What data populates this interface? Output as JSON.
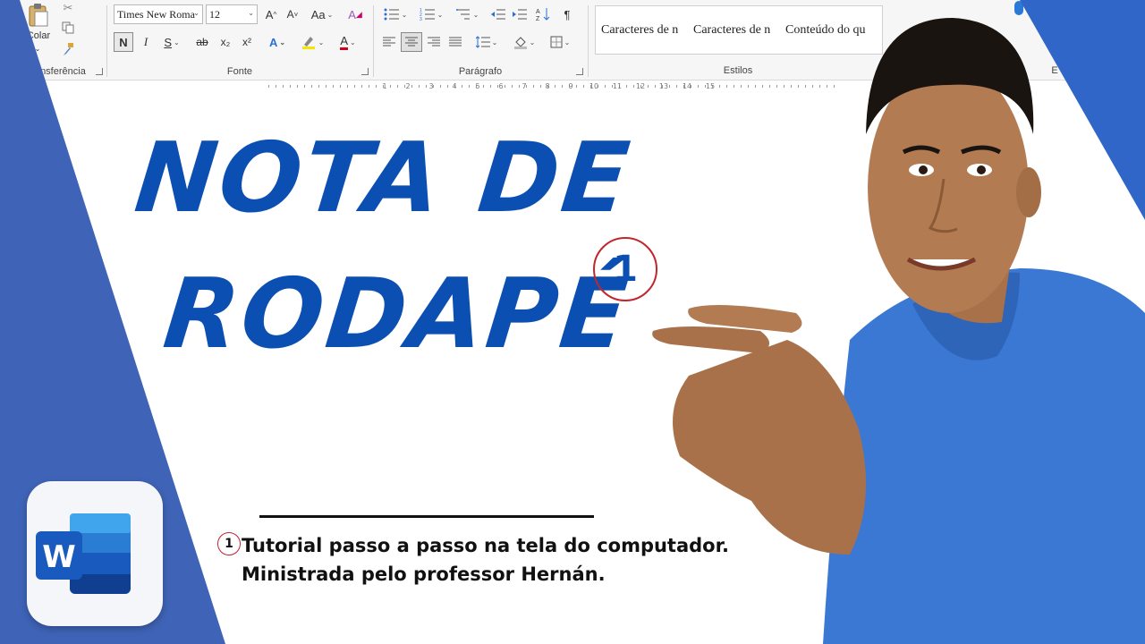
{
  "ribbon": {
    "clipboard": {
      "paste_label": "Colar",
      "group_label": "e Transferência"
    },
    "font": {
      "name_value": "Times New Roma",
      "size_value": "12",
      "grow_label": "A",
      "shrink_label": "A",
      "case_label": "Aa",
      "bold_label": "N",
      "italic_label": "I",
      "underline_label": "S",
      "strike_label": "ab",
      "subscript_label": "x₂",
      "superscript_label": "x²",
      "effects_label": "A",
      "fontcolor_label": "A",
      "group_label": "Fonte"
    },
    "paragraph": {
      "pilcrow_label": "¶",
      "group_label": "Parágrafo"
    },
    "styles": {
      "items": [
        "Caracteres de n",
        "Caracteres de n",
        "Conteúdo do qu"
      ],
      "group_label": "Estilos"
    },
    "edge_label": "E"
  },
  "ruler": {
    "numbers": [
      "1",
      "2",
      "3",
      "4",
      "5",
      "6",
      "7",
      "8",
      "9",
      "10",
      "11",
      "12",
      "13",
      "14",
      "15"
    ]
  },
  "headline": {
    "line1": "NOTA DE",
    "line2": "RODAPÉ",
    "marker": "1"
  },
  "footnote": {
    "marker": "1",
    "line1": "Tutorial passo a passo na tela do computador.",
    "line2": "Ministrada pelo professor Hernán."
  },
  "logo": {
    "letter": "W"
  },
  "colors": {
    "brand_blue": "#0b4fb3",
    "side_blue": "#3f63b6",
    "marker_red": "#c0262d",
    "shirt_blue": "#3a78d4"
  },
  "icons": {
    "clear_format": "eraser-a-icon",
    "scissors": "scissors-icon",
    "copy": "copy-icon",
    "format_painter": "brush-icon",
    "mic": "microphone-icon"
  }
}
